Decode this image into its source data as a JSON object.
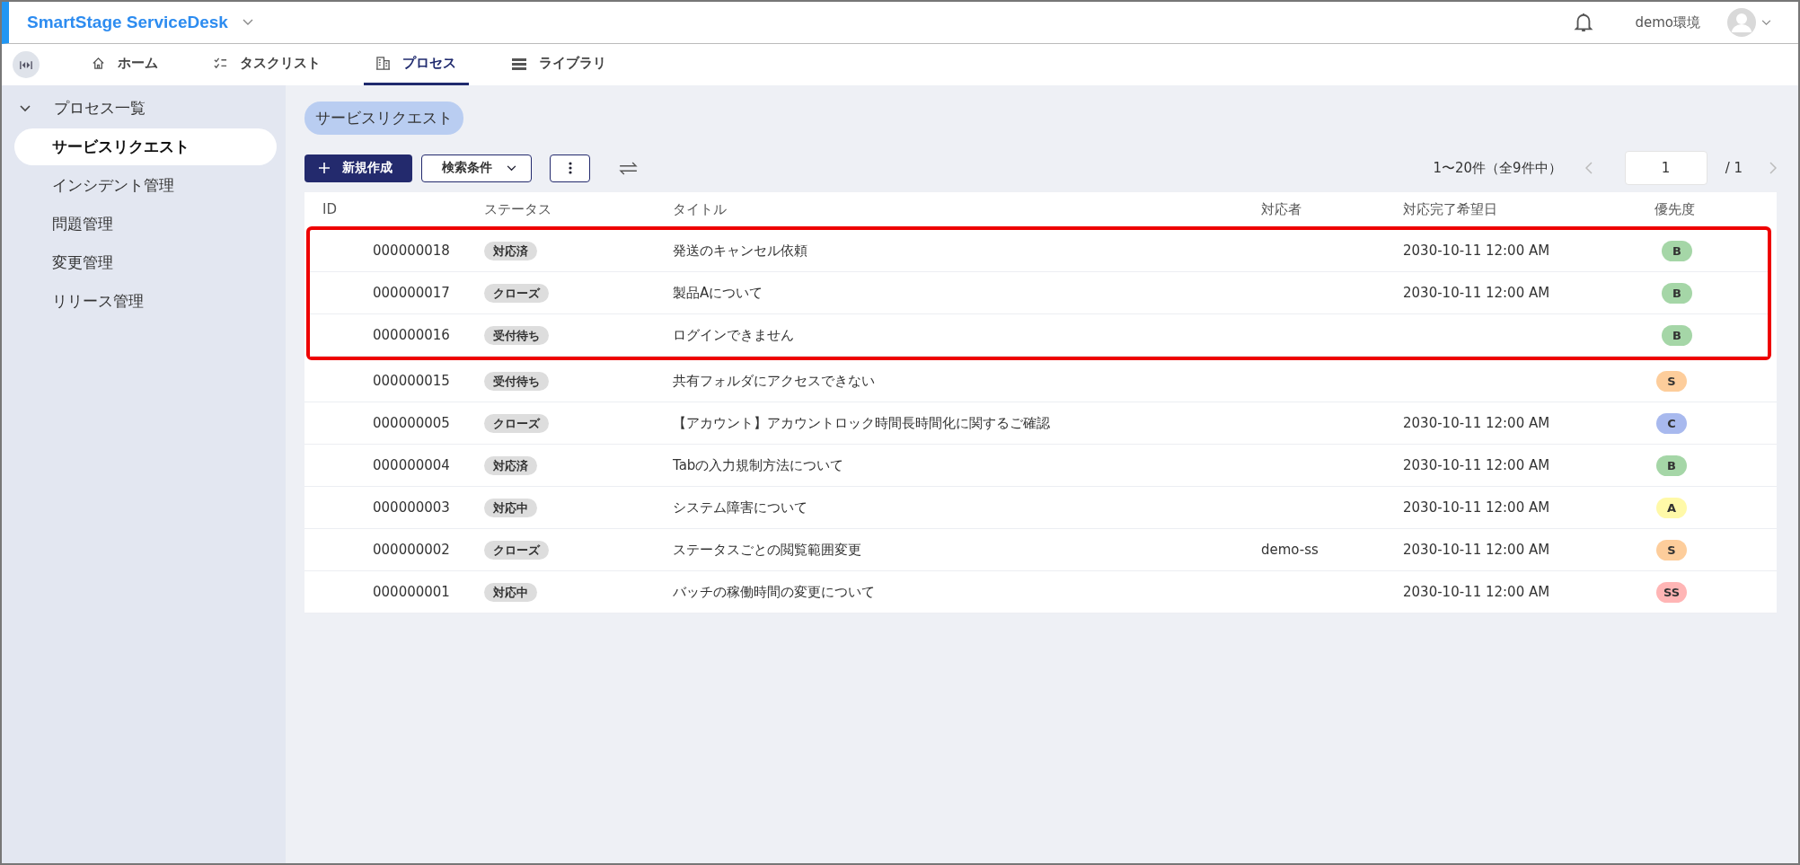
{
  "header": {
    "app_name": "SmartStage ServiceDesk",
    "environment": "demo環境"
  },
  "nav_tabs": [
    {
      "label": "ホーム",
      "selected": false
    },
    {
      "label": "タスクリスト",
      "selected": false
    },
    {
      "label": "プロセス",
      "selected": true
    },
    {
      "label": "ライブラリ",
      "selected": false
    }
  ],
  "sidebar": {
    "group": "プロセス一覧",
    "expanded": true,
    "items": [
      {
        "label": "サービスリクエスト",
        "selected": true
      },
      {
        "label": "インシデント管理",
        "selected": false
      },
      {
        "label": "問題管理",
        "selected": false
      },
      {
        "label": "変更管理",
        "selected": false
      },
      {
        "label": "リリース管理",
        "selected": false
      }
    ]
  },
  "page_chip": "サービスリクエスト",
  "toolbar": {
    "new_button": "新規作成",
    "filter_button": "検索条件"
  },
  "pagination": {
    "summary": "1〜20件（全9件中）",
    "page": "1",
    "total": "/ 1"
  },
  "table": {
    "columns": [
      "ID",
      "ステータス",
      "タイトル",
      "対応者",
      "対応完了希望日",
      "優先度"
    ],
    "rows": [
      {
        "id": "000000018",
        "status": "対応済",
        "title": "発送のキャンセル依頼",
        "assignee": "",
        "due": "2030-10-11 12:00 AM",
        "priority": "B",
        "color": "#a5d6a7",
        "highlighted": true
      },
      {
        "id": "000000017",
        "status": "クローズ",
        "title": "製品Aについて",
        "assignee": "",
        "due": "2030-10-11 12:00 AM",
        "priority": "B",
        "color": "#a5d6a7",
        "highlighted": true
      },
      {
        "id": "000000016",
        "status": "受付待ち",
        "title": "ログインできません",
        "assignee": "",
        "due": "",
        "priority": "B",
        "color": "#a5d6a7",
        "highlighted": true
      },
      {
        "id": "000000015",
        "status": "受付待ち",
        "title": "共有フォルダにアクセスできない",
        "assignee": "",
        "due": "",
        "priority": "S",
        "color": "#fdcd9b",
        "highlighted": false
      },
      {
        "id": "000000005",
        "status": "クローズ",
        "title": "【アカウント】アカウントロック時間長時間化に関するご確認",
        "assignee": "",
        "due": "2030-10-11 12:00 AM",
        "priority": "C",
        "color": "#a8b9ee",
        "highlighted": false
      },
      {
        "id": "000000004",
        "status": "対応済",
        "title": "Tabの入力規制方法について",
        "assignee": "",
        "due": "2030-10-11 12:00 AM",
        "priority": "B",
        "color": "#a5d6a7",
        "highlighted": false
      },
      {
        "id": "000000003",
        "status": "対応中",
        "title": "システム障害について",
        "assignee": "",
        "due": "2030-10-11 12:00 AM",
        "priority": "A",
        "color": "#fff9a8",
        "highlighted": false
      },
      {
        "id": "000000002",
        "status": "クローズ",
        "title": "ステータスごとの閲覧範囲変更",
        "assignee": "demo-ss",
        "due": "2030-10-11 12:00 AM",
        "priority": "S",
        "color": "#fdcd9b",
        "highlighted": false
      },
      {
        "id": "000000001",
        "status": "対応中",
        "title": "バッチの稼働時間の変更について",
        "assignee": "",
        "due": "2030-10-11 12:00 AM",
        "priority": "SS",
        "color": "#ffb5b5",
        "highlighted": false
      }
    ]
  }
}
